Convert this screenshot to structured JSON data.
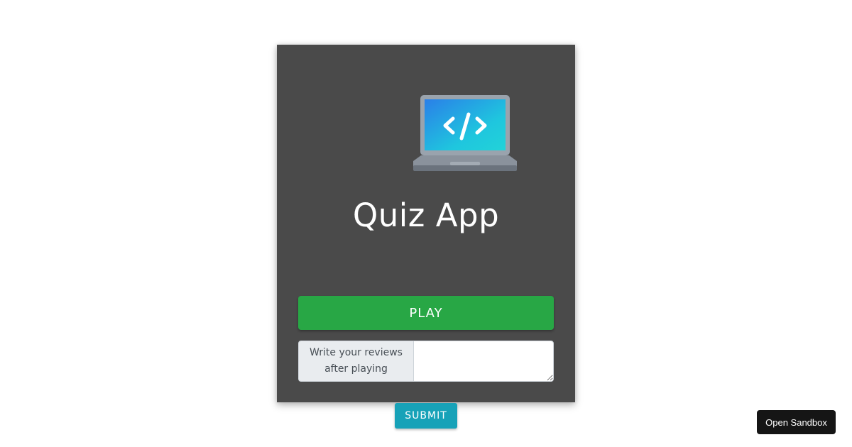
{
  "app": {
    "title": "Quiz App",
    "logo_icon": "laptop-code-icon"
  },
  "actions": {
    "play_label": "PLAY",
    "submit_label": "SUBMIT"
  },
  "review": {
    "label": "Write your reviews after playing",
    "value": "",
    "placeholder": ""
  },
  "sandbox": {
    "label": "Open Sandbox"
  },
  "colors": {
    "card_background": "#4a4a4a",
    "play_button": "#28a745",
    "submit_button": "#17a2b8",
    "sandbox_button": "#151515"
  }
}
